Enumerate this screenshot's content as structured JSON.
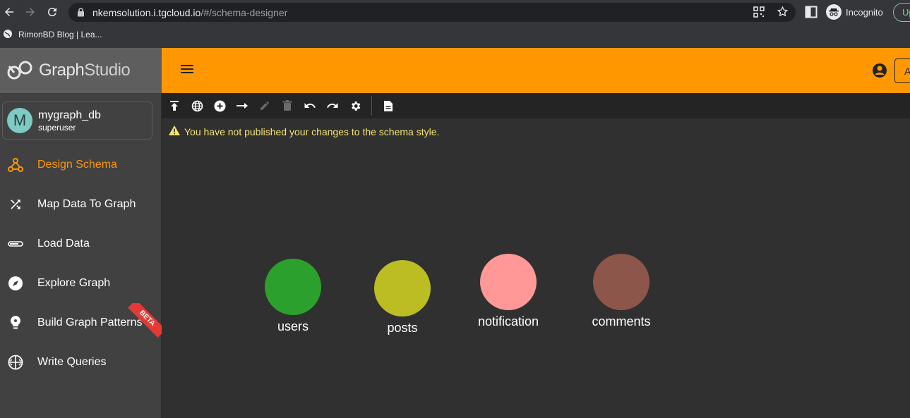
{
  "browser": {
    "url_host": "nkemsolution.i.tgcloud.io",
    "url_path": "/#/schema-designer",
    "profile_label": "Incognito",
    "update_label": "Up",
    "bookmark_label": "RimonBD Blog | Lea..."
  },
  "app": {
    "logo_graph": "Graph",
    "logo_studio": "Studio",
    "account_button_label": "A"
  },
  "user": {
    "initial": "M",
    "name": "mygraph_db",
    "role": "superuser"
  },
  "sidebar": {
    "items": [
      {
        "label": "Design Schema",
        "icon": "schema-icon",
        "active": true
      },
      {
        "label": "Map Data To Graph",
        "icon": "shuffle-icon"
      },
      {
        "label": "Load Data",
        "icon": "progress-bar-icon"
      },
      {
        "label": "Explore Graph",
        "icon": "compass-icon"
      },
      {
        "label": "Build Graph Patterns",
        "icon": "lightbulb-icon",
        "badge": "BETA"
      },
      {
        "label": "Write Queries",
        "icon": "code-globe-icon"
      }
    ]
  },
  "warning": {
    "message": "You have not published your changes to the schema style."
  },
  "schema": {
    "vertices": [
      {
        "label": "users",
        "color": "#2ca02c"
      },
      {
        "label": "posts",
        "color": "#bcbd22"
      },
      {
        "label": "notification",
        "color": "#ff9896"
      },
      {
        "label": "comments",
        "color": "#8c564b"
      }
    ]
  },
  "colors": {
    "accent": "#ff9800",
    "warning_text": "#f4e36d"
  }
}
